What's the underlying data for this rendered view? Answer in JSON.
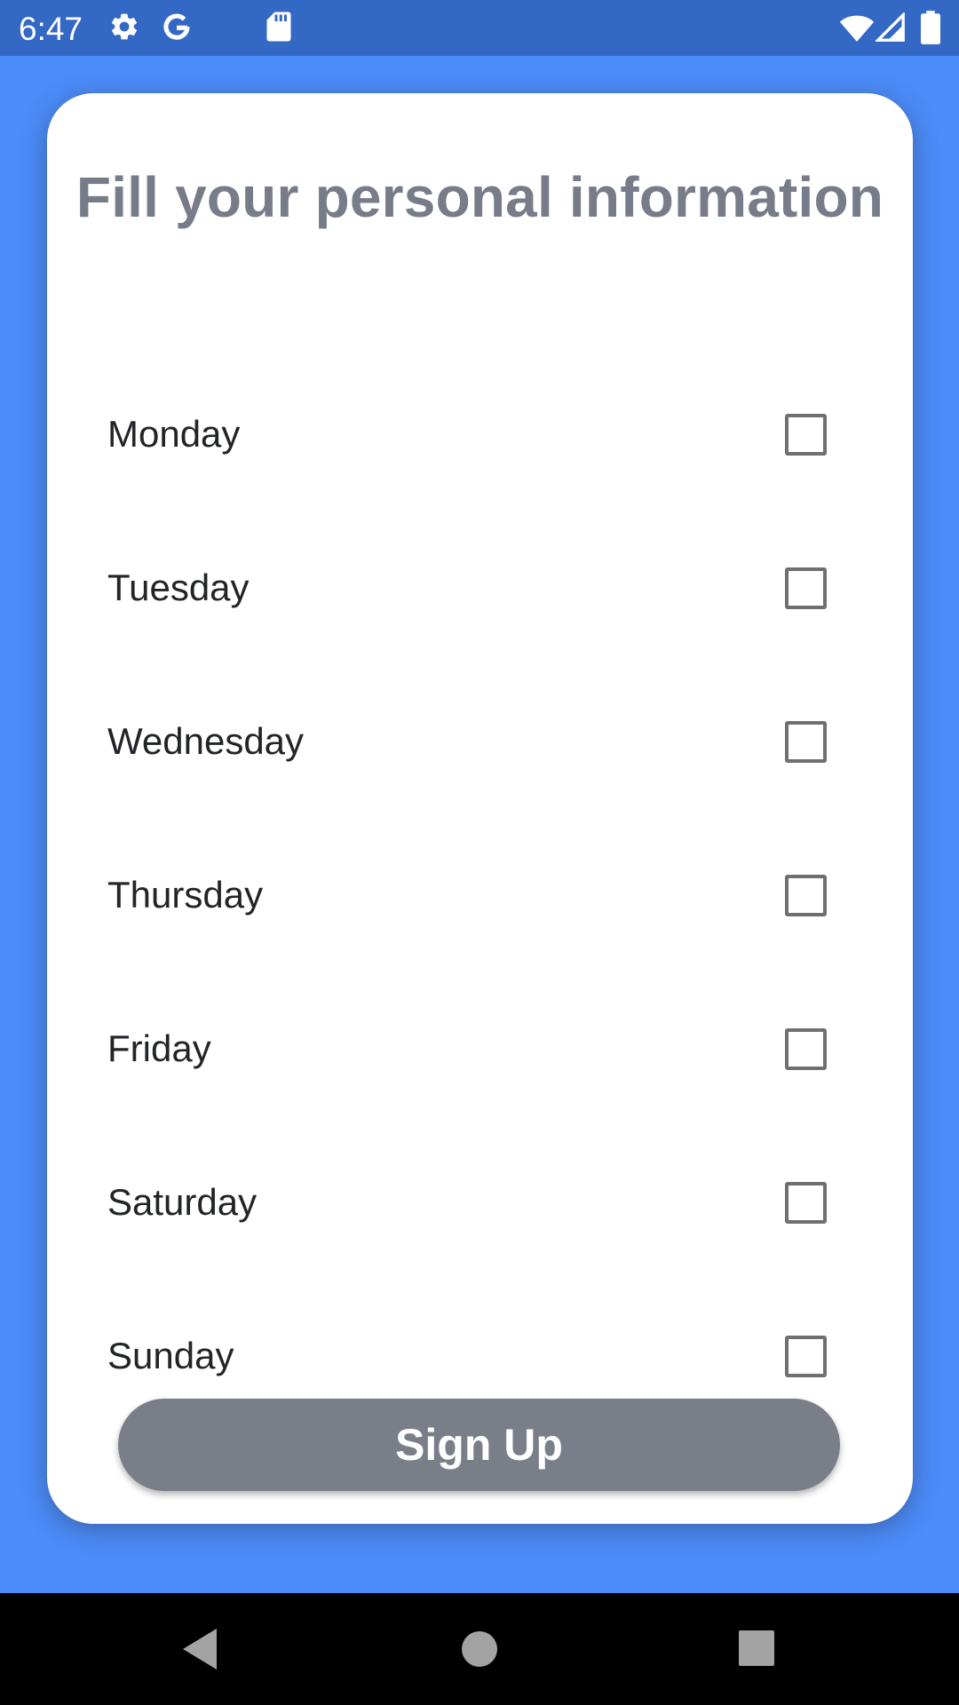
{
  "status_bar": {
    "time": "6:47",
    "icons": [
      "gear-icon",
      "google-icon",
      "sd-card-icon",
      "wifi-icon",
      "signal-icon",
      "battery-icon"
    ]
  },
  "card": {
    "title": "Fill your personal information",
    "days": [
      {
        "label": "Monday",
        "checked": false
      },
      {
        "label": "Tuesday",
        "checked": false
      },
      {
        "label": "Wednesday",
        "checked": false
      },
      {
        "label": "Thursday",
        "checked": false
      },
      {
        "label": "Friday",
        "checked": false
      },
      {
        "label": "Saturday",
        "checked": false
      },
      {
        "label": "Sunday",
        "checked": false
      }
    ],
    "signup_label": "Sign Up"
  },
  "nav_bar": {
    "icons": [
      "back-icon",
      "home-icon",
      "recents-icon"
    ]
  },
  "colors": {
    "background": "#4b8cf8",
    "status_bar": "#3468c5",
    "card": "#ffffff",
    "title_text": "#777c88",
    "button": "#7a7e89",
    "nav_bar": "#000000"
  }
}
